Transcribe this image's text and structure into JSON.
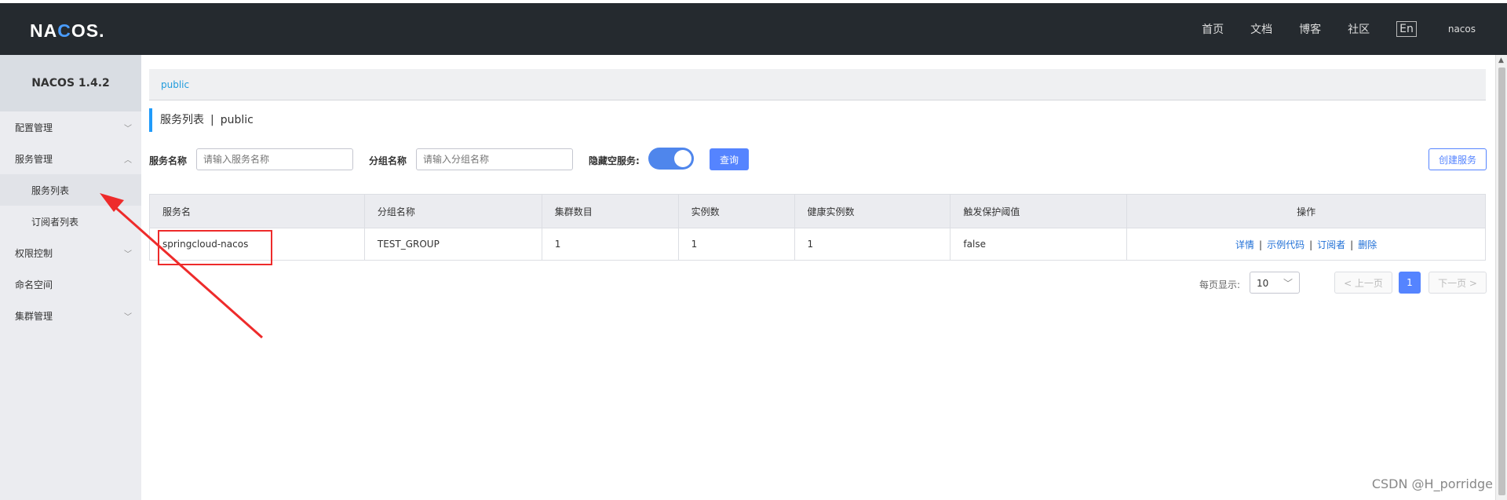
{
  "header": {
    "logo_left": "NA",
    "logo_mid": "C",
    "logo_right": "OS.",
    "nav": [
      "首页",
      "文档",
      "博客",
      "社区"
    ],
    "lang": "En",
    "user": "nacos"
  },
  "sidebar": {
    "version": "NACOS 1.4.2",
    "items": [
      {
        "label": "配置管理"
      },
      {
        "label": "服务管理"
      },
      {
        "label": "服务列表"
      },
      {
        "label": "订阅者列表"
      },
      {
        "label": "权限控制"
      },
      {
        "label": "命名空间"
      },
      {
        "label": "集群管理"
      }
    ]
  },
  "namespace": {
    "link": "public"
  },
  "page": {
    "title": "服务列表",
    "sep": "|",
    "namespace": "public"
  },
  "search": {
    "service_label": "服务名称",
    "service_placeholder": "请输入服务名称",
    "group_label": "分组名称",
    "group_placeholder": "请输入分组名称",
    "hide_empty_label": "隐藏空服务:",
    "hide_empty_enabled": true,
    "query_button": "查询",
    "create_button": "创建服务"
  },
  "table": {
    "headers": [
      "服务名",
      "分组名称",
      "集群数目",
      "实例数",
      "健康实例数",
      "触发保护阈值",
      "操作"
    ],
    "rows": [
      {
        "service": "springcloud-nacos",
        "group": "TEST_GROUP",
        "clusters": "1",
        "instances": "1",
        "healthy": "1",
        "threshold": "false",
        "ops": [
          "详情",
          "示例代码",
          "订阅者",
          "删除"
        ]
      }
    ]
  },
  "pagination": {
    "per_page_label": "每页显示:",
    "per_page_value": "10",
    "prev": "< 上一页",
    "current": "1",
    "next": "下一页 >"
  },
  "colors": {
    "primary": "#5584ff",
    "header_bg": "#252a2f",
    "annotation": "#ee2b2b"
  },
  "watermark": "CSDN @H_porridge"
}
